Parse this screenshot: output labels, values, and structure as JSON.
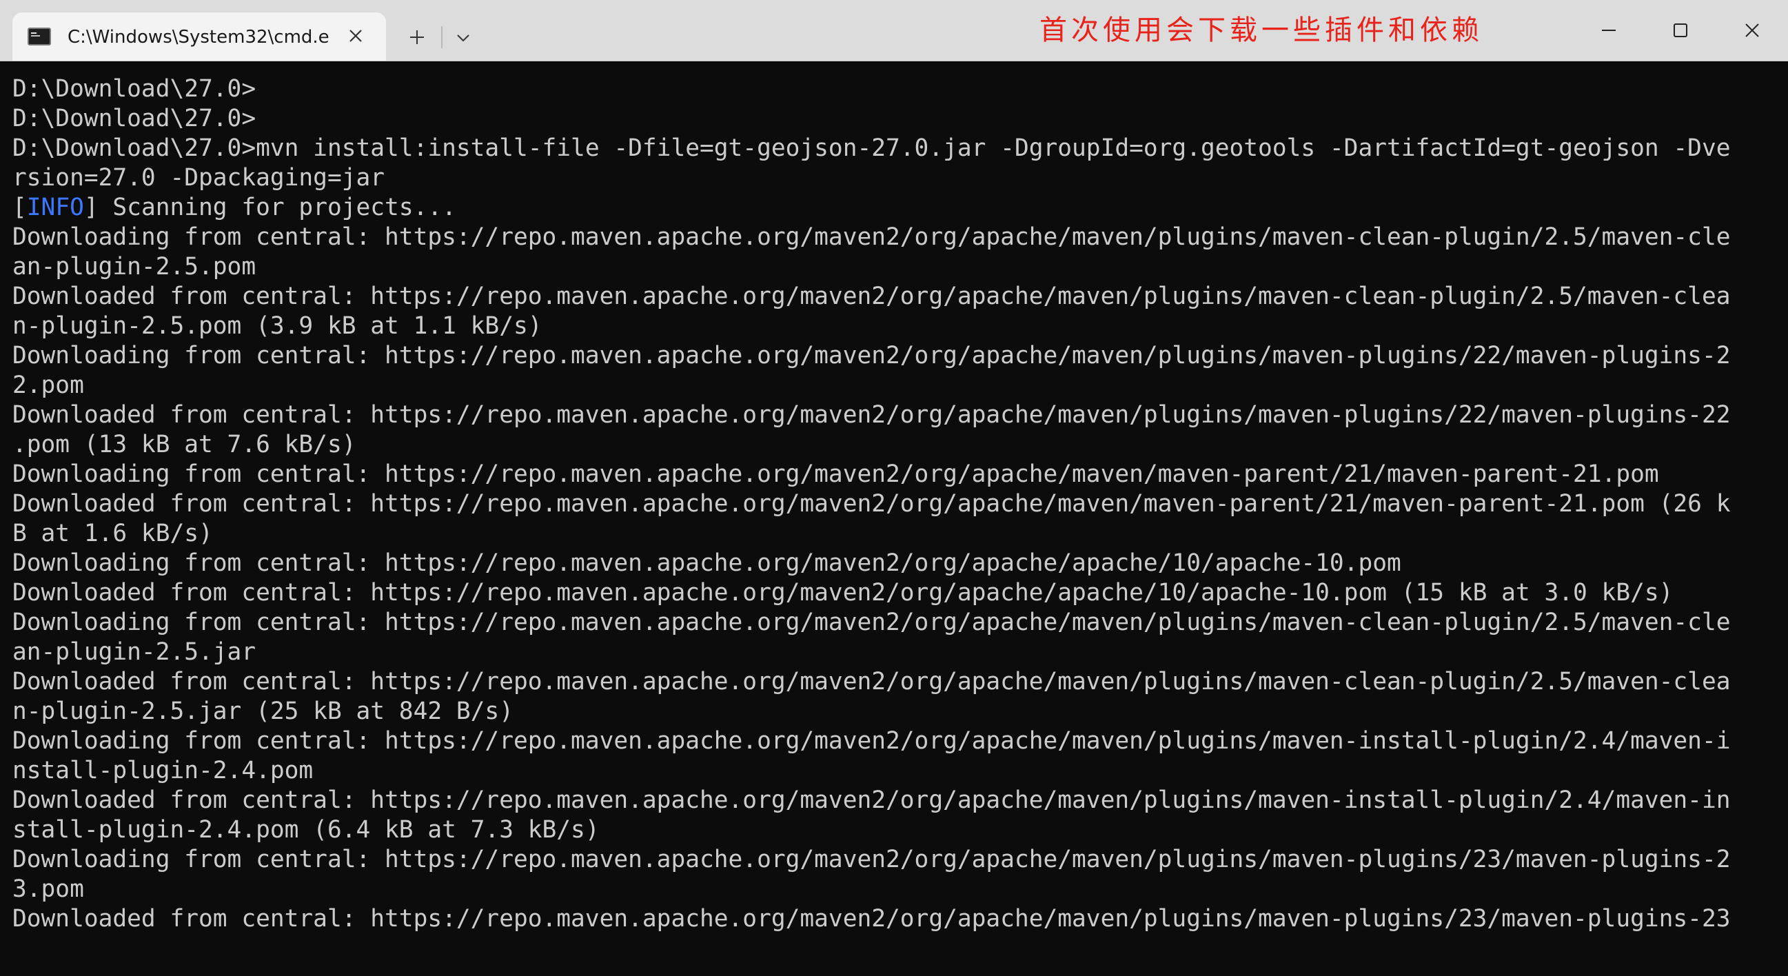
{
  "window": {
    "tab_title": "C:\\Windows\\System32\\cmd.e",
    "annotation": "首次使用会下载一些插件和依赖"
  },
  "icons": {
    "tab": "cmd-terminal-icon",
    "tab_close": "close-icon",
    "new_tab": "plus-icon",
    "dropdown": "chevron-down-icon",
    "minimize": "minimize-icon",
    "maximize": "maximize-icon",
    "close": "close-icon"
  },
  "colors": {
    "background": "#0c0c0c",
    "text": "#cccccc",
    "info": "#3b78ff",
    "annotation": "#e8231b",
    "titlebar": "#dcdcdc",
    "tab": "#f3f3f3"
  },
  "console": {
    "lines": [
      "D:\\Download\\27.0>",
      "D:\\Download\\27.0>",
      "D:\\Download\\27.0>mvn install:install-file -Dfile=gt-geojson-27.0.jar -DgroupId=org.geotools -DartifactId=gt-geojson -Dve",
      "rsion=27.0 -Dpackaging=jar",
      {
        "prefix": "[",
        "info": "INFO",
        "suffix": "] Scanning for projects..."
      },
      "Downloading from central: https://repo.maven.apache.org/maven2/org/apache/maven/plugins/maven-clean-plugin/2.5/maven-cle",
      "an-plugin-2.5.pom",
      "Downloaded from central: https://repo.maven.apache.org/maven2/org/apache/maven/plugins/maven-clean-plugin/2.5/maven-clea",
      "n-plugin-2.5.pom (3.9 kB at 1.1 kB/s)",
      "Downloading from central: https://repo.maven.apache.org/maven2/org/apache/maven/plugins/maven-plugins/22/maven-plugins-2",
      "2.pom",
      "Downloaded from central: https://repo.maven.apache.org/maven2/org/apache/maven/plugins/maven-plugins/22/maven-plugins-22",
      ".pom (13 kB at 7.6 kB/s)",
      "Downloading from central: https://repo.maven.apache.org/maven2/org/apache/maven/maven-parent/21/maven-parent-21.pom",
      "Downloaded from central: https://repo.maven.apache.org/maven2/org/apache/maven/maven-parent/21/maven-parent-21.pom (26 k",
      "B at 1.6 kB/s)",
      "Downloading from central: https://repo.maven.apache.org/maven2/org/apache/apache/10/apache-10.pom",
      "Downloaded from central: https://repo.maven.apache.org/maven2/org/apache/apache/10/apache-10.pom (15 kB at 3.0 kB/s)",
      "Downloading from central: https://repo.maven.apache.org/maven2/org/apache/maven/plugins/maven-clean-plugin/2.5/maven-cle",
      "an-plugin-2.5.jar",
      "Downloaded from central: https://repo.maven.apache.org/maven2/org/apache/maven/plugins/maven-clean-plugin/2.5/maven-clea",
      "n-plugin-2.5.jar (25 kB at 842 B/s)",
      "Downloading from central: https://repo.maven.apache.org/maven2/org/apache/maven/plugins/maven-install-plugin/2.4/maven-i",
      "nstall-plugin-2.4.pom",
      "Downloaded from central: https://repo.maven.apache.org/maven2/org/apache/maven/plugins/maven-install-plugin/2.4/maven-in",
      "stall-plugin-2.4.pom (6.4 kB at 7.3 kB/s)",
      "Downloading from central: https://repo.maven.apache.org/maven2/org/apache/maven/plugins/maven-plugins/23/maven-plugins-2",
      "3.pom",
      "Downloaded from central: https://repo.maven.apache.org/maven2/org/apache/maven/plugins/maven-plugins/23/maven-plugins-23"
    ]
  }
}
